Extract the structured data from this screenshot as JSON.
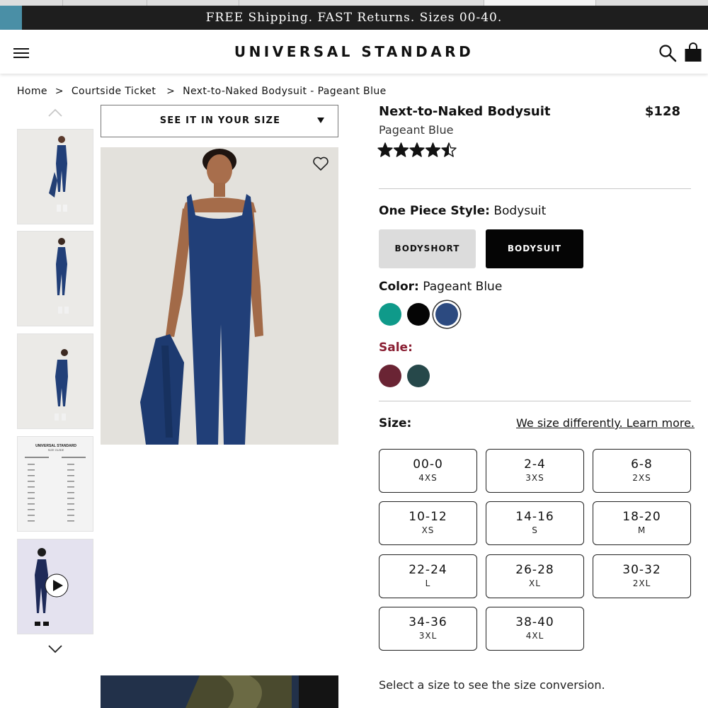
{
  "promo": {
    "text": "FREE Shipping. FAST Returns. Sizes 00-40."
  },
  "header": {
    "logo": "UNIVERSAL STANDARD",
    "icons": [
      "menu-icon",
      "search-icon",
      "shopping-bag-icon"
    ]
  },
  "breadcrumb": {
    "items": [
      "Home",
      "Courtside Ticket",
      "Next-to-Naked Bodysuit - Pageant Blue"
    ],
    "separator": ">"
  },
  "gallery": {
    "dropdown_label": "SEE IT IN YOUR SIZE",
    "icons": [
      "chevron-up-icon",
      "chevron-down-icon",
      "heart-icon",
      "play-icon"
    ],
    "size_guide": {
      "title": "UNIVERSAL STANDARD",
      "subtitle": "SIZE GUIDE"
    }
  },
  "product": {
    "name": "Next-to-Naked Bodysuit",
    "price": "$128",
    "color_name": "Pageant Blue",
    "rating": 4.5,
    "rating_max": 5
  },
  "style": {
    "label": "One Piece Style:",
    "value": "Bodysuit",
    "options": [
      {
        "label": "BODYSHORT",
        "selected": false
      },
      {
        "label": "BODYSUIT",
        "selected": true
      }
    ]
  },
  "color": {
    "label": "Color:",
    "value": "Pageant Blue",
    "swatches": [
      {
        "name": "teal",
        "hex": "#0f9a8a",
        "selected": false
      },
      {
        "name": "black",
        "hex": "#050505",
        "selected": false
      },
      {
        "name": "pageant-blue",
        "hex": "#2c4a80",
        "selected": true
      }
    ],
    "sale_label": "Sale:",
    "sale_swatches": [
      {
        "name": "burgundy",
        "hex": "#6a2434"
      },
      {
        "name": "dark-teal",
        "hex": "#26484a"
      }
    ]
  },
  "size": {
    "label": "Size:",
    "link": "We size differently. Learn more.",
    "options": [
      {
        "us": "00-0",
        "alpha": "4XS"
      },
      {
        "us": "2-4",
        "alpha": "3XS"
      },
      {
        "us": "6-8",
        "alpha": "2XS"
      },
      {
        "us": "10-12",
        "alpha": "XS"
      },
      {
        "us": "14-16",
        "alpha": "S"
      },
      {
        "us": "18-20",
        "alpha": "M"
      },
      {
        "us": "22-24",
        "alpha": "L"
      },
      {
        "us": "26-28",
        "alpha": "XL"
      },
      {
        "us": "30-32",
        "alpha": "2XL"
      },
      {
        "us": "34-36",
        "alpha": "3XL"
      },
      {
        "us": "38-40",
        "alpha": "4XL"
      }
    ],
    "conversion_text": "Select a size to see the size conversion."
  },
  "colors": {
    "promo_bg": "#1e1e1e",
    "garment": "#213f78",
    "sale_text": "#8a1f33"
  }
}
